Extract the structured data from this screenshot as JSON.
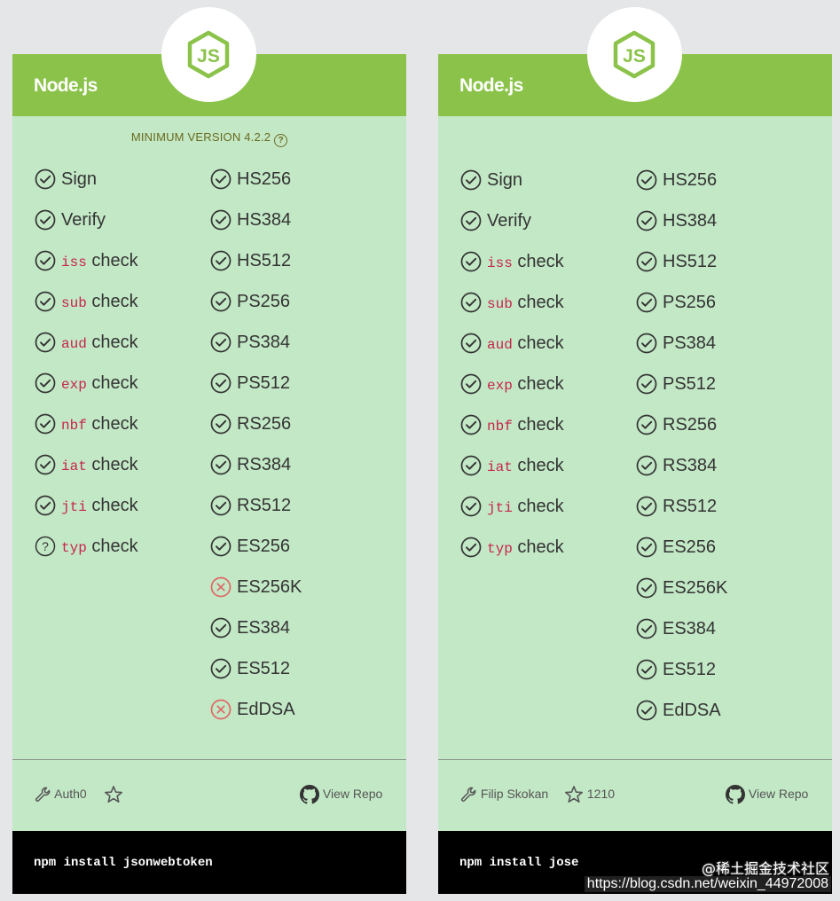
{
  "cards": [
    {
      "lib_name": "Node.js",
      "min_version": "MINIMUM VERSION 4.2.2",
      "checks": [
        {
          "status": "ok",
          "claim": "",
          "text": "Sign"
        },
        {
          "status": "ok",
          "claim": "",
          "text": "Verify"
        },
        {
          "status": "ok",
          "claim": "iss",
          "text": "check"
        },
        {
          "status": "ok",
          "claim": "sub",
          "text": "check"
        },
        {
          "status": "ok",
          "claim": "aud",
          "text": "check"
        },
        {
          "status": "ok",
          "claim": "exp",
          "text": "check"
        },
        {
          "status": "ok",
          "claim": "nbf",
          "text": "check"
        },
        {
          "status": "ok",
          "claim": "iat",
          "text": "check"
        },
        {
          "status": "ok",
          "claim": "jti",
          "text": "check"
        },
        {
          "status": "unknown",
          "claim": "typ",
          "text": "check"
        }
      ],
      "algorithms": [
        {
          "status": "ok",
          "text": "HS256"
        },
        {
          "status": "ok",
          "text": "HS384"
        },
        {
          "status": "ok",
          "text": "HS512"
        },
        {
          "status": "ok",
          "text": "PS256"
        },
        {
          "status": "ok",
          "text": "PS384"
        },
        {
          "status": "ok",
          "text": "PS512"
        },
        {
          "status": "ok",
          "text": "RS256"
        },
        {
          "status": "ok",
          "text": "RS384"
        },
        {
          "status": "ok",
          "text": "RS512"
        },
        {
          "status": "ok",
          "text": "ES256"
        },
        {
          "status": "no",
          "text": "ES256K"
        },
        {
          "status": "ok",
          "text": "ES384"
        },
        {
          "status": "ok",
          "text": "ES512"
        },
        {
          "status": "no",
          "text": "EdDSA"
        }
      ],
      "author": "Auth0",
      "stars": "",
      "view_repo": "View Repo",
      "install": "npm install jsonwebtoken"
    },
    {
      "lib_name": "Node.js",
      "min_version": "",
      "checks": [
        {
          "status": "ok",
          "claim": "",
          "text": "Sign"
        },
        {
          "status": "ok",
          "claim": "",
          "text": "Verify"
        },
        {
          "status": "ok",
          "claim": "iss",
          "text": "check"
        },
        {
          "status": "ok",
          "claim": "sub",
          "text": "check"
        },
        {
          "status": "ok",
          "claim": "aud",
          "text": "check"
        },
        {
          "status": "ok",
          "claim": "exp",
          "text": "check"
        },
        {
          "status": "ok",
          "claim": "nbf",
          "text": "check"
        },
        {
          "status": "ok",
          "claim": "iat",
          "text": "check"
        },
        {
          "status": "ok",
          "claim": "jti",
          "text": "check"
        },
        {
          "status": "ok",
          "claim": "typ",
          "text": "check"
        }
      ],
      "algorithms": [
        {
          "status": "ok",
          "text": "HS256"
        },
        {
          "status": "ok",
          "text": "HS384"
        },
        {
          "status": "ok",
          "text": "HS512"
        },
        {
          "status": "ok",
          "text": "PS256"
        },
        {
          "status": "ok",
          "text": "PS384"
        },
        {
          "status": "ok",
          "text": "PS512"
        },
        {
          "status": "ok",
          "text": "RS256"
        },
        {
          "status": "ok",
          "text": "RS384"
        },
        {
          "status": "ok",
          "text": "RS512"
        },
        {
          "status": "ok",
          "text": "ES256"
        },
        {
          "status": "ok",
          "text": "ES256K"
        },
        {
          "status": "ok",
          "text": "ES384"
        },
        {
          "status": "ok",
          "text": "ES512"
        },
        {
          "status": "ok",
          "text": "EdDSA"
        }
      ],
      "author": "Filip Skokan",
      "stars": "1210",
      "view_repo": "View Repo",
      "install": "npm install jose"
    }
  ],
  "watermark": "@稀土掘金技术社区",
  "url_watermark": "https://blog.csdn.net/weixin_44972008",
  "colors": {
    "header": "#8bc34a",
    "card": "#c3e8c6",
    "ok_icon": "#333333",
    "no_icon": "#e06666",
    "claim": "#c7254e"
  },
  "icons": {
    "ok": "check-circle-icon",
    "no": "x-circle-icon",
    "unknown": "question-circle-icon"
  }
}
